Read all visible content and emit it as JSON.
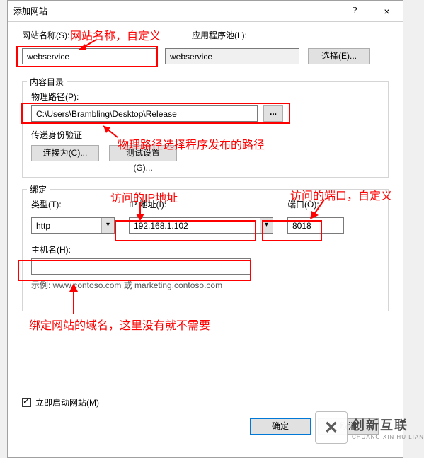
{
  "window": {
    "title": "添加网站",
    "help": "?",
    "close": "×"
  },
  "site_name": {
    "label": "网站名称(S):",
    "value": "webservice"
  },
  "app_pool": {
    "label": "应用程序池(L):",
    "value": "webservice",
    "select_btn": "选择(E)..."
  },
  "content_dir": {
    "group_title": "内容目录",
    "path_label": "物理路径(P):",
    "path_value": "C:\\Users\\Brambling\\Desktop\\Release",
    "browse_btn": "...",
    "passthrough_label": "传递身份验证",
    "connect_btn": "连接为(C)...",
    "test_btn": "测试设置(G)..."
  },
  "binding": {
    "group_title": "绑定",
    "type_label": "类型(T):",
    "type_value": "http",
    "ip_label": "IP 地址(I):",
    "ip_value": "192.168.1.102",
    "port_label": "端口(O):",
    "port_value": "8018",
    "host_label": "主机名(H):",
    "host_value": "",
    "example": "示例: www.contoso.com 或 marketing.contoso.com"
  },
  "start_now": "立即启动网站(M)",
  "footer": {
    "ok": "确定",
    "cancel": "取消"
  },
  "annotations": {
    "a1": "网站名称，自定义",
    "a2": "物理路径选择程序发布的路径",
    "a3": "访问的IP地址",
    "a4": "访问的端口，自定义",
    "a5": "绑定网站的域名，这里没有就不需要"
  },
  "watermark": {
    "cn": "创新互联",
    "en": "CHUANG XIN HU LIAN"
  }
}
